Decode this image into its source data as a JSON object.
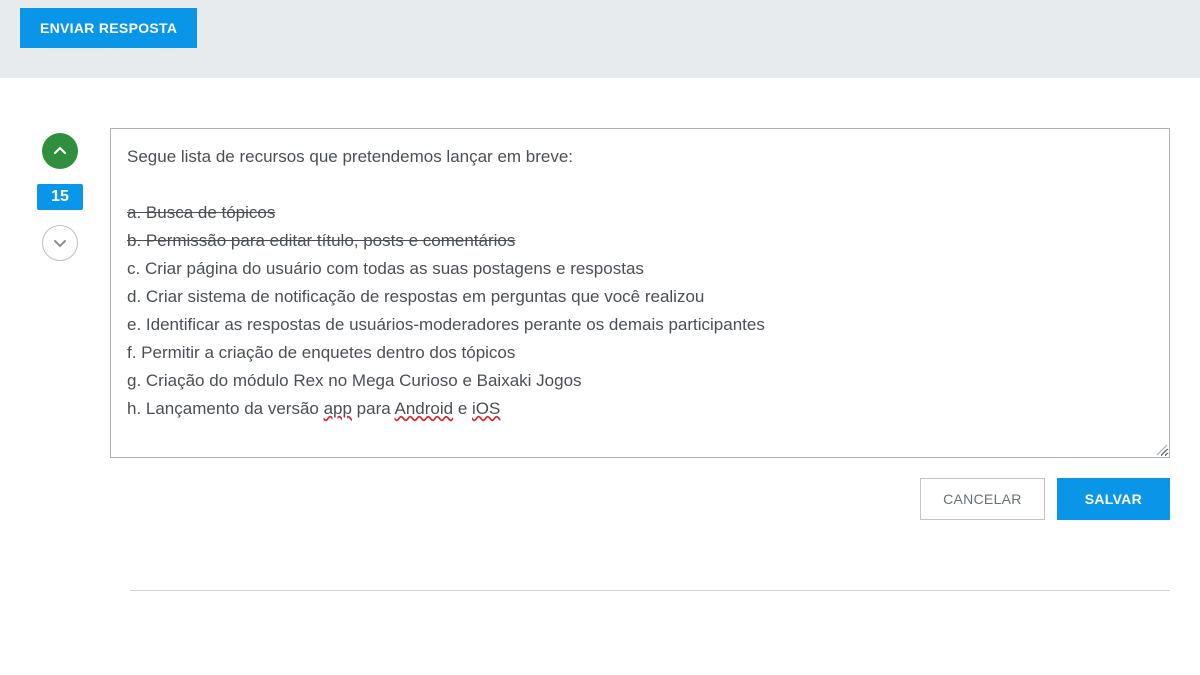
{
  "topBar": {
    "sendReply": "ENVIAR RESPOSTA"
  },
  "vote": {
    "count": "15"
  },
  "editor": {
    "intro": "Segue lista de recursos que pretendemos lançar em breve:",
    "items": [
      {
        "prefix": "a. ",
        "text": "Busca de tópicos",
        "strike": true
      },
      {
        "prefix": "b. ",
        "text": "Permissão para editar título, posts e comentários",
        "strike": true
      },
      {
        "prefix": "c. ",
        "text": "Criar página do usuário com todas as suas postagens e respostas",
        "strike": false
      },
      {
        "prefix": "d. ",
        "text": "Criar sistema de notificação de respostas em perguntas que você realizou",
        "strike": false
      },
      {
        "prefix": "e. ",
        "text": "Identificar as respostas de usuários-moderadores perante os demais participantes",
        "strike": false
      },
      {
        "prefix": "f. ",
        "text": "Permitir a criação de enquetes dentro dos tópicos",
        "strike": false
      },
      {
        "prefix": "g. ",
        "text": "Criação do módulo Rex no Mega Curioso e Baixaki Jogos",
        "strike": false
      }
    ],
    "lastLine": {
      "prefix": "h. Lançamento da versão ",
      "word1": "app",
      "mid1": " para ",
      "word2": "Android",
      "mid2": " e ",
      "word3": "iOS"
    }
  },
  "buttons": {
    "cancel": "CANCELAR",
    "save": "SALVAR"
  }
}
